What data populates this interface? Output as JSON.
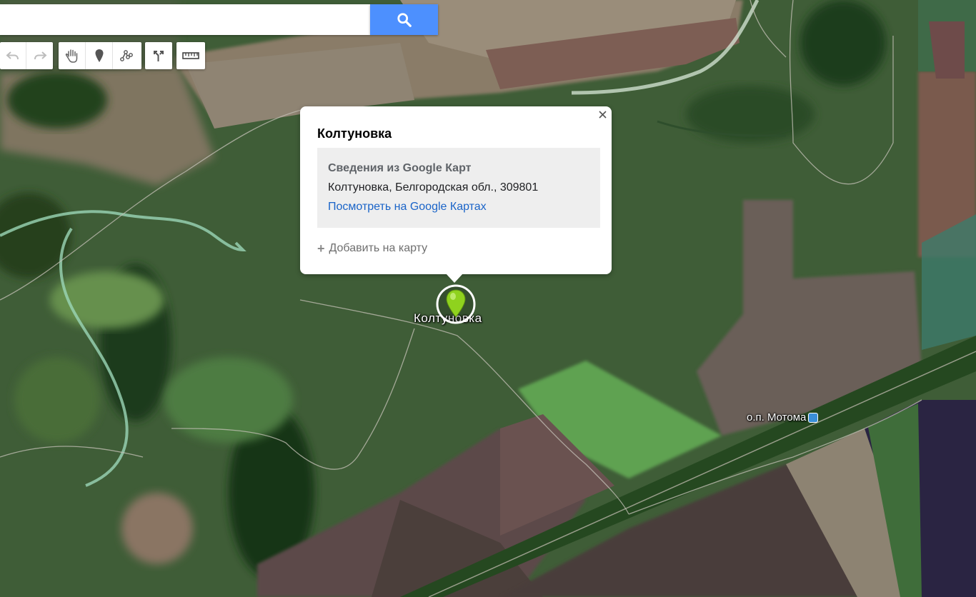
{
  "search": {
    "placeholder": "",
    "value": "",
    "button_icon": "search-icon"
  },
  "toolbar": {
    "history": [
      {
        "icon": "undo-icon",
        "enabled": false
      },
      {
        "icon": "redo-icon",
        "enabled": false
      }
    ],
    "tools": [
      {
        "icon": "pan-hand-icon"
      },
      {
        "icon": "add-marker-icon"
      },
      {
        "icon": "draw-line-icon"
      },
      {
        "icon": "directions-icon"
      },
      {
        "icon": "ruler-icon"
      }
    ]
  },
  "info_window": {
    "title": "Колтуновка",
    "card_heading": "Сведения из Google Карт",
    "address": "Колтуновка, Белгородская обл., 309801",
    "link_text": "Посмотреть на Google Картах",
    "add_to_map": "Добавить на карту",
    "close_icon": "close-icon"
  },
  "map_labels": {
    "village": "Колтуновка",
    "station": "о.п. Мотома"
  },
  "colors": {
    "search_button": "#4d90fe",
    "link": "#1a64c8",
    "marker": "#8fd21e",
    "station_icon": "#3a8fd8"
  }
}
